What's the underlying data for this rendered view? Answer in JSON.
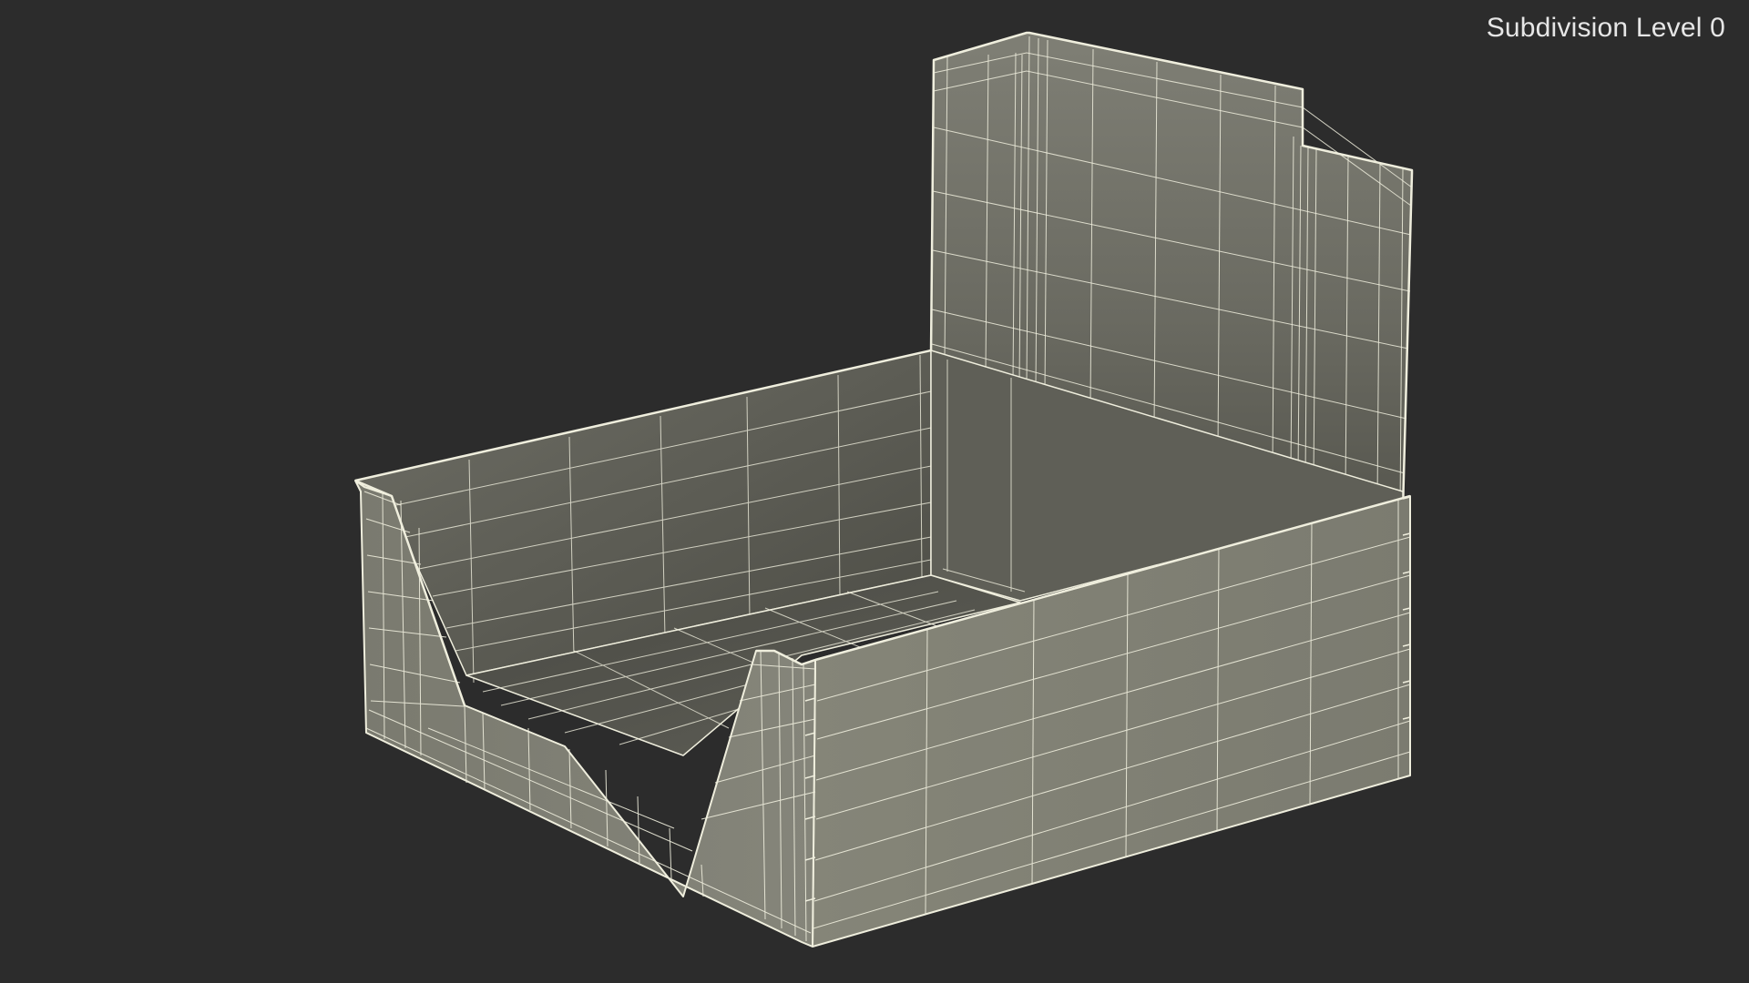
{
  "viewport": {
    "subdivision_label": "Subdivision Level 0",
    "background_color": "#2c2c2c",
    "wireframe_color": "#efeedd",
    "label_color": "#e6e6e6"
  },
  "model": {
    "render_mode": "wireframe-on-shaded",
    "object": "display-box"
  }
}
